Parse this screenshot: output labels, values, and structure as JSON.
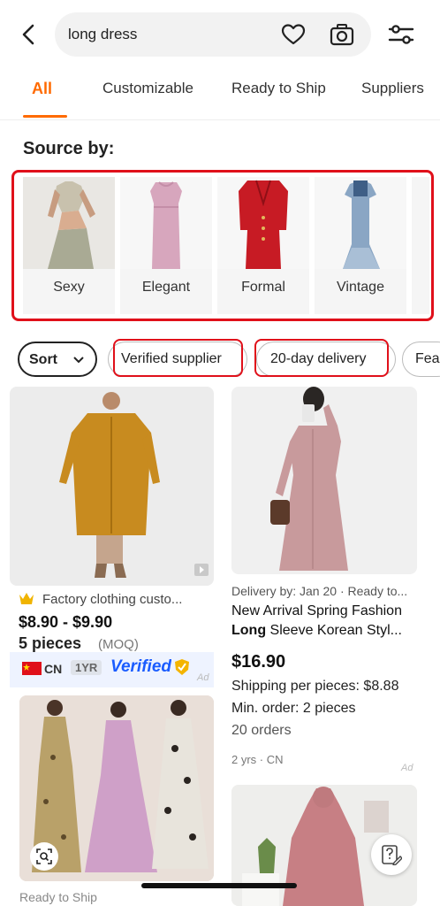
{
  "search": {
    "query": "long dress"
  },
  "tabs": [
    "All",
    "Customizable",
    "Ready to Ship",
    "Suppliers"
  ],
  "source_by": {
    "title": "Source by:",
    "categories": [
      "Sexy",
      "Elegant",
      "Formal",
      "Vintage"
    ]
  },
  "filters": {
    "sort": "Sort",
    "chips": [
      "Verified supplier",
      "20-day delivery",
      "Fea"
    ]
  },
  "products": {
    "p1": {
      "store_line": "Factory clothing custo...",
      "price": "$8.90 - $9.90",
      "moq_value": "5 pieces",
      "moq_label": "(MOQ)",
      "country": "CN",
      "years": "1YR",
      "verified": "Verified",
      "ad": "Ad"
    },
    "p2": {
      "delivery": "Delivery by: Jan 20 · Ready to...",
      "title_line1": "New Arrival Spring Fashion",
      "title_bold": "Long",
      "title_line2_rest": " Sleeve Korean Styl...",
      "price": "$16.90",
      "shipping": "Shipping per pieces: $8.88",
      "min_order": "Min. order: 2 pieces",
      "orders": "20 orders",
      "origin": "2 yrs · CN",
      "ad": "Ad"
    },
    "p3": {
      "badge": "Ready to Ship"
    }
  },
  "colors": {
    "accent": "#ff6a00",
    "highlight": "#e0101a",
    "verified": "#1a5cff"
  }
}
